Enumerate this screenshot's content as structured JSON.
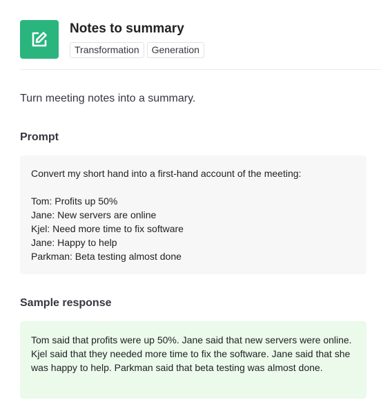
{
  "header": {
    "icon": "edit-icon",
    "title": "Notes to summary",
    "tags": [
      "Transformation",
      "Generation"
    ]
  },
  "description": "Turn meeting notes into a summary.",
  "prompt": {
    "heading": "Prompt",
    "lines": [
      "Convert my short hand into a first-hand account of the meeting:",
      "",
      "Tom: Profits up 50%",
      "Jane: New servers are online",
      "Kjel: Need more time to fix software",
      "Jane: Happy to help",
      "Parkman: Beta testing almost done"
    ]
  },
  "sample_response": {
    "heading": "Sample response",
    "text": "Tom said that profits were up 50%. Jane said that new servers were online. Kjel said that they needed more time to fix the software. Jane said that she was happy to help. Parkman said that beta testing was almost done."
  },
  "colors": {
    "icon_bg": "#2bb57e",
    "prompt_bg": "#f7f7f8",
    "response_bg": "#ebfaeb"
  }
}
